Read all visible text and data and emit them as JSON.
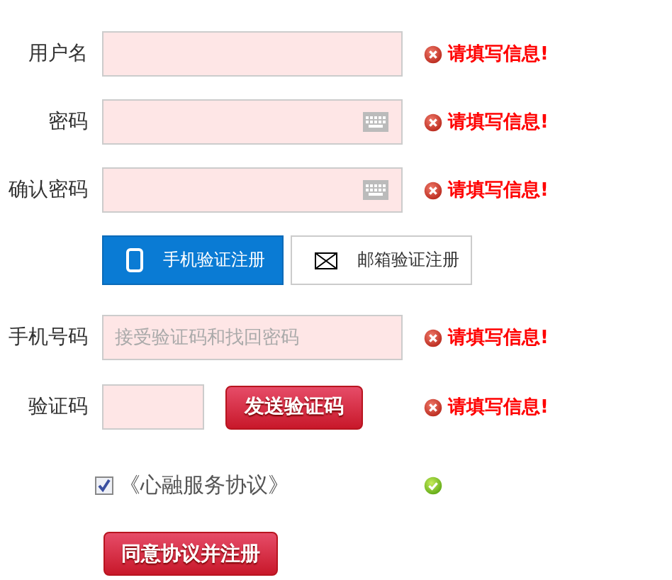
{
  "account_fields": [
    {
      "kind": "text",
      "label": "用户名",
      "valid": false,
      "message": "请填写信息!"
    },
    {
      "kind": "password",
      "label": "密码",
      "valid": false,
      "message": "请填写信息!"
    },
    {
      "kind": "password",
      "label": "确认密码",
      "valid": false,
      "message": "请填写信息!"
    }
  ],
  "register_tabs": [
    {
      "kind": "phone",
      "label": "手机验证注册",
      "selected": true
    },
    {
      "kind": "mail",
      "label": "邮箱验证注册",
      "selected": false
    }
  ],
  "phone_fields": [
    {
      "kind": "text",
      "label": "手机号码",
      "placeholder": "接受验证码和找回密码",
      "valid": false,
      "message": "请填写信息!"
    },
    {
      "kind": "code",
      "label": "验证码",
      "button": "发送验证码",
      "valid": false,
      "message": "请填写信息!"
    }
  ],
  "agreement": {
    "checked": true,
    "label": "《心融服务协议》",
    "valid": true
  },
  "submit_button": "同意协议并注册"
}
